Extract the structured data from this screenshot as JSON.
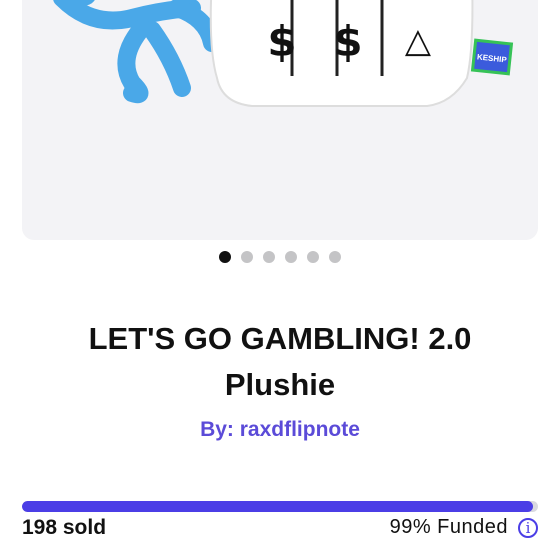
{
  "product": {
    "title": "LET'S GO GAMBLING! 2.0 Plushie",
    "byline_prefix": "By: ",
    "creator": "raxdflipnote",
    "image_tag_text": "KESHIP",
    "symbols": [
      "$",
      "$",
      "△"
    ]
  },
  "carousel": {
    "dot_count": 6,
    "active_index": 0
  },
  "funding": {
    "sold_label": "198 sold",
    "funded_label": "99% Funded",
    "progress_fraction": 0.99
  },
  "colors": {
    "accent": "#4b3ee6",
    "link": "#5b4bd8",
    "plush_blue": "#4aa8e8"
  },
  "icons": {
    "info": "info-icon"
  }
}
